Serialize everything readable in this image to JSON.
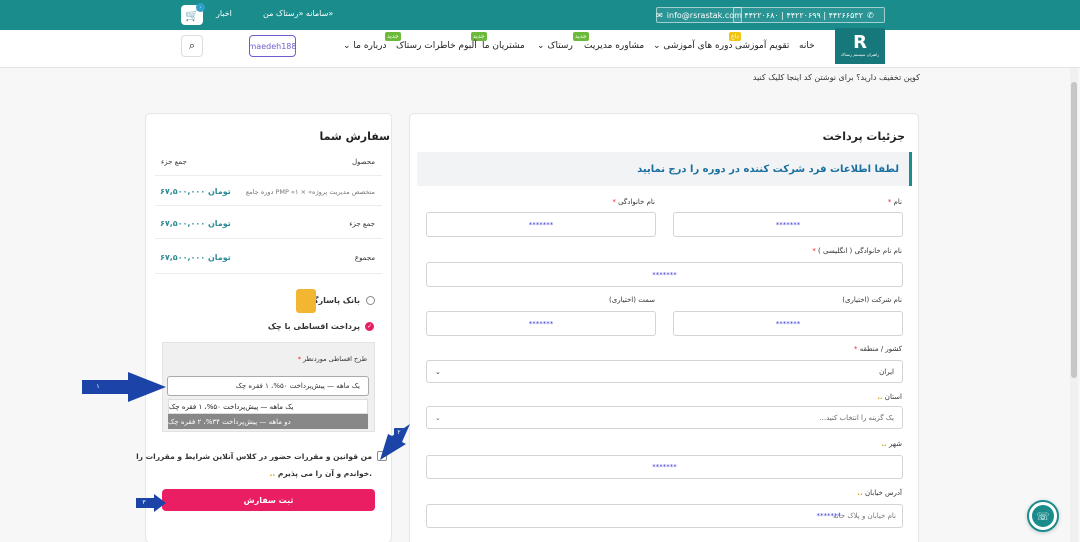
{
  "topbar": {
    "phones": "۴۴۲۲۰۶۸۰ | ۴۴۲۲۰۶۹۹ | ۴۴۲۶۶۵۳۲",
    "email": "info@rsrastak.com",
    "promo": "سامانه «رستاک من»",
    "news": "اخبار",
    "cart_count": "۰"
  },
  "logo": {
    "mark": "R",
    "sub": "راهبران سیستم رستاک"
  },
  "nav": {
    "home": "خانه",
    "calendar": "تقویم آموزشی",
    "courses": "دوره های آموزشی",
    "consulting": "مشاوره مدیریت",
    "rastak": "رستاک",
    "customers": "مشتریان ما",
    "album": "آلبوم خاطرات رستاک",
    "about": "درباره ما",
    "new_tag": "جدید",
    "hot_tag": "داغ",
    "user": "maedeh188"
  },
  "coupon_text": "کوپن تخفیف دارید؟ برای نوشتن کد اینجا کلیک کنید",
  "order": {
    "title": "سفارش شما",
    "col_product": "محصول",
    "col_total": "جمع جزء",
    "item_name": "دوره جامع PMP «متخصص مدیریت پروژه» × ۱",
    "item_price": "۶۷,۵۰۰,۰۰۰ تومان",
    "subtotal_label": "جمع جزء",
    "subtotal_value": "۶۷,۵۰۰,۰۰۰ تومان",
    "total_label": "مجموع",
    "total_value": "۶۷,۵۰۰,۰۰۰ تومان",
    "bank_label": "بانک پاسارگاد",
    "installment_label": "پرداخت اقساطی با چک",
    "plan_label": "طرح اقساطی موردنظر",
    "plan_selected": "یک ماهه — پیش‌پرداخت ۵۰%، ۱ فقره چک",
    "plan_options": [
      "یک ماهه — پیش‌پرداخت ۵۰%، ۱ فقره چک",
      "دو ماهه — پیش‌پرداخت ۳۴%، ۲ فقره چک"
    ],
    "terms_line1": "من قوانین و مقررات حضور در کلاس آنلاین شرایط و مقررات را",
    "terms_line2": "خواندم و آن را می پذیرم.",
    "submit": "ثبت سفارش"
  },
  "billing": {
    "title": "جزئیات پرداخت",
    "notice": "لطفا اطلاعات فرد شرکت کننده در دوره را درج نمایید",
    "first_name_label": "نام",
    "last_name_label": "نام خانوادگی",
    "first_name_value": "*******",
    "last_name_value": "*******",
    "en_name_label": "نام نام خانوادگی ( انگلیسی )",
    "en_name_value": "*******",
    "company_label": "نام شرکت (اختیاری)",
    "company_value": "*******",
    "position_label": "سمت (اختیاری)",
    "position_value": "*******",
    "country_label": "کشور / منطقه",
    "country_value": "ایران",
    "province_label": "استان",
    "province_placeholder": "یک گزینه را انتخاب کنید...",
    "city_label": "شهر",
    "city_value": "*******",
    "street_label": "آدرس خیابان",
    "street_placeholder": "نام خیابان و پلاک خانه",
    "street_value": "*******"
  },
  "annotations": {
    "n1": "۱",
    "n2": "۲",
    "n3": "۳"
  },
  "colors": {
    "teal": "#1a8c8c",
    "pink": "#ea1e63",
    "arrow": "#1c44a8"
  }
}
